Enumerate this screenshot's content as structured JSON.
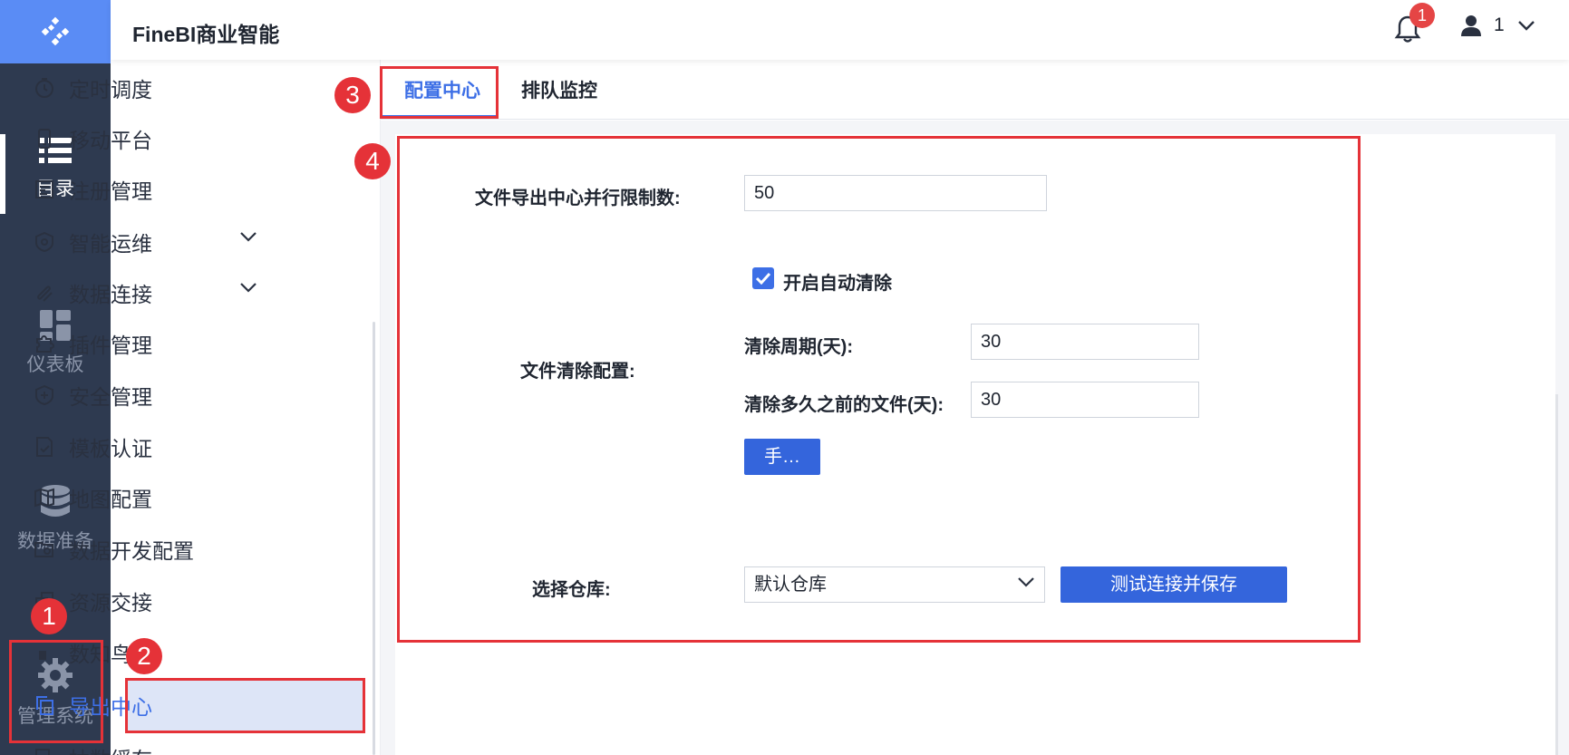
{
  "app": {
    "title": "FineBI商业智能"
  },
  "header": {
    "notification_count": "1",
    "user_name": "1"
  },
  "rail": {
    "items": [
      {
        "label": "目录",
        "icon": "list-icon"
      },
      {
        "label": "仪表板",
        "icon": "dashboard-icon"
      },
      {
        "label": "数据准备",
        "icon": "database-icon"
      },
      {
        "label": "管理系统",
        "icon": "gear-icon"
      }
    ]
  },
  "sidebar": {
    "items": [
      {
        "label": "定时调度",
        "icon": "timer-icon"
      },
      {
        "label": "移动平台",
        "icon": "mobile-icon"
      },
      {
        "label": "注册管理",
        "icon": "register-icon"
      },
      {
        "label": "智能运维",
        "icon": "ops-icon",
        "expandable": true
      },
      {
        "label": "数据连接",
        "icon": "link-icon",
        "expandable": true
      },
      {
        "label": "插件管理",
        "icon": "puzzle-icon"
      },
      {
        "label": "安全管理",
        "icon": "shield-icon"
      },
      {
        "label": "模板认证",
        "icon": "template-icon"
      },
      {
        "label": "地图配置",
        "icon": "map-icon"
      },
      {
        "label": "数据开发配置",
        "icon": "folder-gear-icon"
      },
      {
        "label": "资源交接",
        "icon": "handover-icon"
      },
      {
        "label": "数知鸟",
        "icon": "bird-icon"
      },
      {
        "label": "导出中心",
        "icon": "copy-icon",
        "selected": true
      },
      {
        "label": "抽数缓存",
        "icon": "cache-icon"
      }
    ]
  },
  "tabs": [
    {
      "label": "配置中心",
      "active": true
    },
    {
      "label": "排队监控",
      "active": false
    }
  ],
  "form": {
    "concurrency_label": "文件导出中心并行限制数:",
    "concurrency_value": "50",
    "auto_clean_label": "开启自动清除",
    "auto_clean_checked": true,
    "clean_config_label": "文件清除配置:",
    "clean_period_label": "清除周期(天):",
    "clean_period_value": "30",
    "clean_before_label": "清除多久之前的文件(天):",
    "clean_before_value": "30",
    "manual_button_label": "手…",
    "warehouse_label": "选择仓库:",
    "warehouse_value": "默认仓库",
    "test_save_button_label": "测试连接并保存"
  },
  "annotations": {
    "markers": [
      "1",
      "2",
      "3",
      "4"
    ],
    "color": "#e53238"
  },
  "colors": {
    "accent": "#3d6fe6",
    "rail_bg": "#2e3a50",
    "logo_bg": "#5a8cf5",
    "badge": "#e54545"
  }
}
